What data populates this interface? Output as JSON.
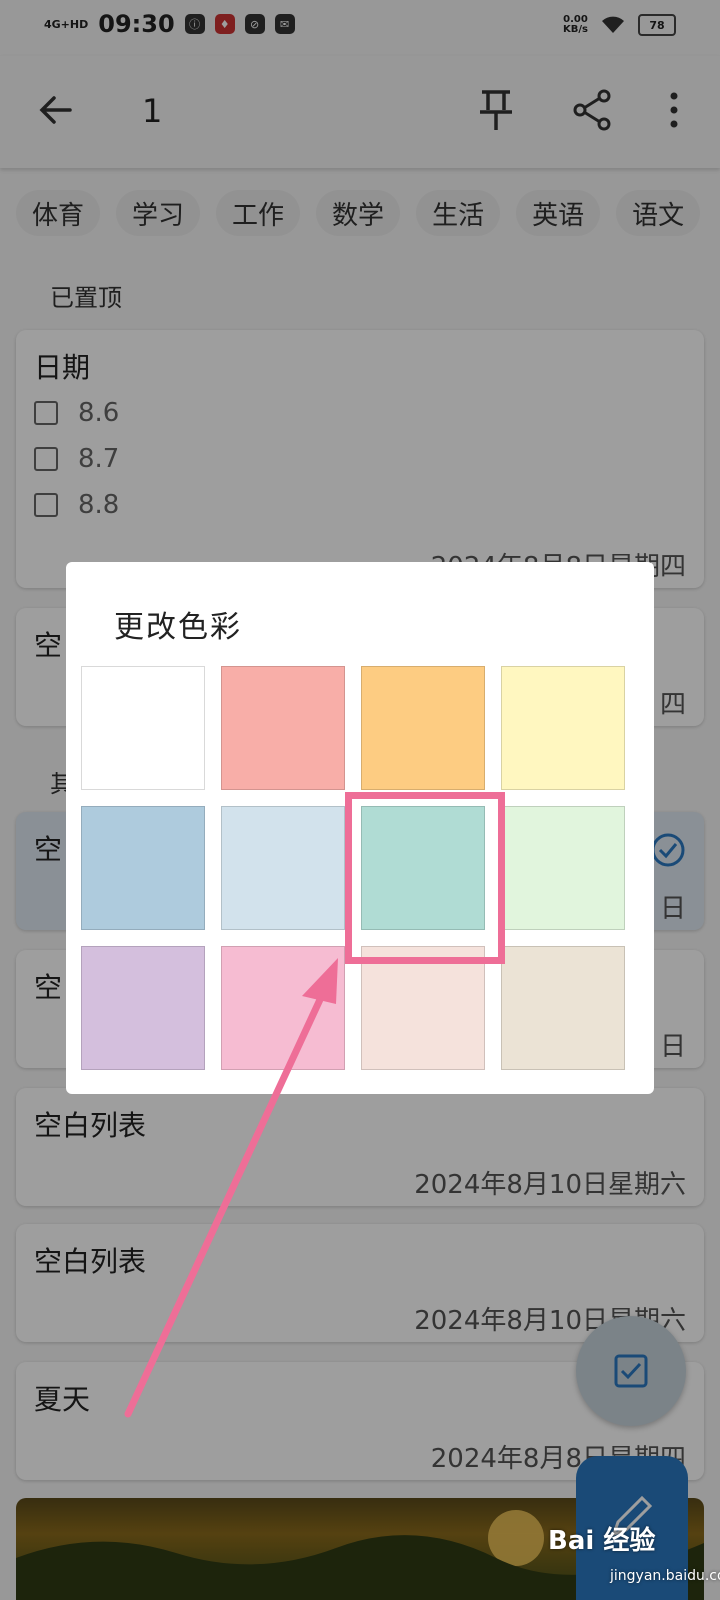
{
  "status_bar": {
    "signal": "4G+HD",
    "time": "09:30",
    "app_icons": [
      "ⓘ",
      "♦",
      "⊘",
      "✉"
    ],
    "network_speed": "0.00",
    "network_unit": "KB/s",
    "battery": "78"
  },
  "app_bar": {
    "title": "1",
    "icons": [
      "back-arrow-icon",
      "pin-icon",
      "share-icon",
      "more-vert-icon"
    ]
  },
  "tags": [
    "体育",
    "学习",
    "工作",
    "数学",
    "生活",
    "英语",
    "语文"
  ],
  "sections": {
    "pinned_label": "已置顶",
    "other_label": "其"
  },
  "notes": [
    {
      "title": "日期",
      "checklist": [
        "8.6",
        "8.7",
        "8.8"
      ],
      "date": "2024年8月8日星期四"
    },
    {
      "title": "空",
      "date": "四"
    },
    {
      "title": "空",
      "date": "日",
      "checked": true
    },
    {
      "title": "空",
      "date": "日"
    },
    {
      "title": "空白列表",
      "date": "2024年8月10日星期六"
    },
    {
      "title": "空白列表",
      "date": "2024年8月10日星期六"
    },
    {
      "title": "夏天",
      "date": "2024年8月8日星期四"
    }
  ],
  "color_dialog": {
    "title": "更改色彩",
    "swatches": [
      "#ffffff",
      "#f8aea8",
      "#fdcc82",
      "#fff7c0",
      "#aecbdd",
      "#d2e2ec",
      "#b0dcd4",
      "#e1f5dd",
      "#d4bfdd",
      "#f6bcd2",
      "#f5e2dc",
      "#ebe3d5"
    ],
    "highlighted_index": 6
  },
  "annotation": {
    "color": "#ee6e97"
  },
  "fab": {
    "checklist_icon": "checkbox-icon",
    "edit_icon": "pencil-icon"
  },
  "watermark": {
    "text": "Bai 经验",
    "sub": "jingyan.baidu.com"
  }
}
